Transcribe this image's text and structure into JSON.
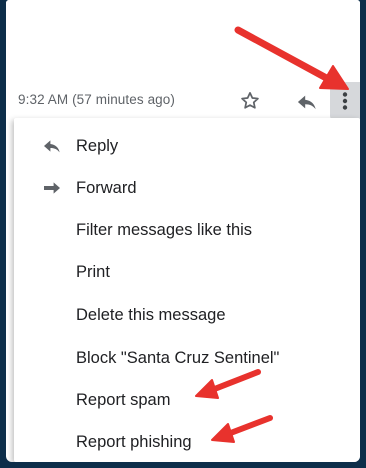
{
  "header": {
    "timestamp": "9:32 AM (57 minutes ago)",
    "star_icon": "star-outline-icon",
    "reply_icon": "reply-arrow-icon",
    "more_icon": "more-vert-icon"
  },
  "menu": {
    "items": [
      {
        "label": "Reply",
        "icon": "reply-icon"
      },
      {
        "label": "Forward",
        "icon": "forward-icon"
      },
      {
        "label": "Filter messages like this"
      },
      {
        "label": "Print"
      },
      {
        "label": "Delete this message"
      },
      {
        "label": "Block \"Santa Cruz Sentinel\""
      },
      {
        "label": "Report spam"
      },
      {
        "label": "Report phishing"
      }
    ]
  },
  "annotations": {
    "arrow_color": "#e8322d"
  },
  "colors": {
    "background": "#0d2e4a",
    "text": "#202124",
    "muted": "#5f6368",
    "icon": "#5f6368"
  }
}
